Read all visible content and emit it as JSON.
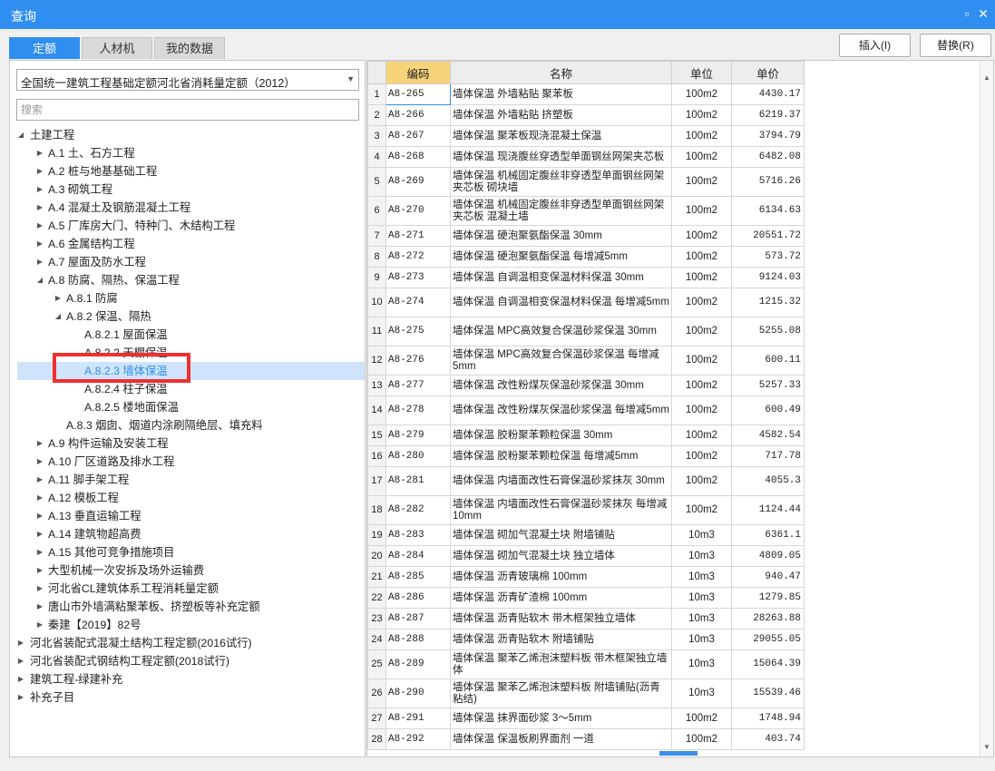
{
  "window": {
    "title": "查询"
  },
  "tabs": [
    {
      "label": "定额",
      "active": true
    },
    {
      "label": "人材机",
      "active": false
    },
    {
      "label": "我的数据",
      "active": false
    }
  ],
  "actions": {
    "insert_label": "插入(I)",
    "replace_label": "替换(R)"
  },
  "left": {
    "quota_book": "全国统一建筑工程基础定额河北省消耗量定额（2012）",
    "search_placeholder": "搜索",
    "tree": [
      {
        "label": "土建工程",
        "level": 1,
        "toggle": "expanded"
      },
      {
        "label": "A.1 土、石方工程",
        "level": 2,
        "toggle": "collapsed"
      },
      {
        "label": "A.2 桩与地基基础工程",
        "level": 2,
        "toggle": "collapsed"
      },
      {
        "label": "A.3 砌筑工程",
        "level": 2,
        "toggle": "collapsed"
      },
      {
        "label": "A.4 混凝土及钢筋混凝土工程",
        "level": 2,
        "toggle": "collapsed"
      },
      {
        "label": "A.5 厂库房大门、特种门、木结构工程",
        "level": 2,
        "toggle": "collapsed"
      },
      {
        "label": "A.6 金属结构工程",
        "level": 2,
        "toggle": "collapsed"
      },
      {
        "label": "A.7 屋面及防水工程",
        "level": 2,
        "toggle": "collapsed"
      },
      {
        "label": "A.8 防腐、隔热、保温工程",
        "level": 2,
        "toggle": "expanded"
      },
      {
        "label": "A.8.1 防腐",
        "level": 3,
        "toggle": "collapsed"
      },
      {
        "label": "A.8.2 保温、隔热",
        "level": 3,
        "toggle": "expanded"
      },
      {
        "label": "A.8.2.1 屋面保温",
        "level": 4,
        "toggle": "none"
      },
      {
        "label": "A.8.2.2 天棚保温",
        "level": 4,
        "toggle": "none"
      },
      {
        "label": "A.8.2.3 墙体保温",
        "level": 4,
        "toggle": "none",
        "selected": true
      },
      {
        "label": "A.8.2.4 柱子保温",
        "level": 4,
        "toggle": "none"
      },
      {
        "label": "A.8.2.5 楼地面保温",
        "level": 4,
        "toggle": "none"
      },
      {
        "label": "A.8.3 烟囱、烟道内涂刷隔绝层、填充料",
        "level": 3,
        "toggle": "none"
      },
      {
        "label": "A.9 构件运输及安装工程",
        "level": 2,
        "toggle": "collapsed"
      },
      {
        "label": "A.10 厂区道路及排水工程",
        "level": 2,
        "toggle": "collapsed"
      },
      {
        "label": "A.11 脚手架工程",
        "level": 2,
        "toggle": "collapsed"
      },
      {
        "label": "A.12 模板工程",
        "level": 2,
        "toggle": "collapsed"
      },
      {
        "label": "A.13 垂直运输工程",
        "level": 2,
        "toggle": "collapsed"
      },
      {
        "label": "A.14 建筑物超高费",
        "level": 2,
        "toggle": "collapsed"
      },
      {
        "label": "A.15 其他可竞争措施项目",
        "level": 2,
        "toggle": "collapsed"
      },
      {
        "label": "大型机械一次安拆及场外运输费",
        "level": 2,
        "toggle": "collapsed"
      },
      {
        "label": "河北省CL建筑体系工程消耗量定额",
        "level": 2,
        "toggle": "collapsed"
      },
      {
        "label": "唐山市外墙满粘聚苯板、挤塑板等补充定额",
        "level": 2,
        "toggle": "collapsed"
      },
      {
        "label": "秦建【2019】82号",
        "level": 2,
        "toggle": "collapsed"
      },
      {
        "label": "河北省装配式混凝土结构工程定额(2016试行)",
        "level": 1,
        "toggle": "collapsed"
      },
      {
        "label": "河北省装配式钢结构工程定额(2018试行)",
        "level": 1,
        "toggle": "collapsed"
      },
      {
        "label": "建筑工程-绿建补充",
        "level": 1,
        "toggle": "collapsed"
      },
      {
        "label": "补充子目",
        "level": 1,
        "toggle": "collapsed"
      }
    ]
  },
  "table": {
    "columns": [
      "编码",
      "名称",
      "单位",
      "单价"
    ],
    "rows": [
      {
        "n": "1",
        "code": "A8-265",
        "name": "墙体保温 外墙粘贴 聚苯板",
        "unit": "100m2",
        "price": "4430.17"
      },
      {
        "n": "2",
        "code": "A8-266",
        "name": "墙体保温 外墙粘贴 挤塑板",
        "unit": "100m2",
        "price": "6219.37"
      },
      {
        "n": "3",
        "code": "A8-267",
        "name": "墙体保温 聚苯板现浇混凝土保温",
        "unit": "100m2",
        "price": "3794.79"
      },
      {
        "n": "4",
        "code": "A8-268",
        "name": "墙体保温 现浇腹丝穿透型单面钢丝网架夹芯板",
        "unit": "100m2",
        "price": "6482.08"
      },
      {
        "n": "5",
        "code": "A8-269",
        "name": "墙体保温 机械固定腹丝非穿透型单面钢丝网架夹芯板 砌块墙",
        "unit": "100m2",
        "price": "5716.26"
      },
      {
        "n": "6",
        "code": "A8-270",
        "name": "墙体保温 机械固定腹丝非穿透型单面钢丝网架夹芯板 混凝土墙",
        "unit": "100m2",
        "price": "6134.63"
      },
      {
        "n": "7",
        "code": "A8-271",
        "name": "墙体保温 硬泡聚氨酯保温 30mm",
        "unit": "100m2",
        "price": "20551.72"
      },
      {
        "n": "8",
        "code": "A8-272",
        "name": "墙体保温 硬泡聚氨酯保温 每增减5mm",
        "unit": "100m2",
        "price": "573.72"
      },
      {
        "n": "9",
        "code": "A8-273",
        "name": "墙体保温 自调温相变保温材料保温 30mm",
        "unit": "100m2",
        "price": "9124.03"
      },
      {
        "n": "10",
        "code": "A8-274",
        "name": "墙体保温 自调温相变保温材料保温 每增减5mm",
        "unit": "100m2",
        "price": "1215.32"
      },
      {
        "n": "11",
        "code": "A8-275",
        "name": "墙体保温 MPC高效复合保温砂浆保温 30mm",
        "unit": "100m2",
        "price": "5255.08"
      },
      {
        "n": "12",
        "code": "A8-276",
        "name": "墙体保温 MPC高效复合保温砂浆保温 每增减5mm",
        "unit": "100m2",
        "price": "600.11"
      },
      {
        "n": "13",
        "code": "A8-277",
        "name": "墙体保温 改性粉煤灰保温砂浆保温 30mm",
        "unit": "100m2",
        "price": "5257.33"
      },
      {
        "n": "14",
        "code": "A8-278",
        "name": "墙体保温 改性粉煤灰保温砂浆保温 每增减5mm",
        "unit": "100m2",
        "price": "600.49"
      },
      {
        "n": "15",
        "code": "A8-279",
        "name": "墙体保温 胶粉聚苯颗粒保温 30mm",
        "unit": "100m2",
        "price": "4582.54"
      },
      {
        "n": "16",
        "code": "A8-280",
        "name": "墙体保温 胶粉聚苯颗粒保温 每增减5mm",
        "unit": "100m2",
        "price": "717.78"
      },
      {
        "n": "17",
        "code": "A8-281",
        "name": "墙体保温 内墙面改性石膏保温砂浆抹灰 30mm",
        "unit": "100m2",
        "price": "4055.3"
      },
      {
        "n": "18",
        "code": "A8-282",
        "name": "墙体保温 内墙面改性石膏保温砂浆抹灰 每增减10mm",
        "unit": "100m2",
        "price": "1124.44"
      },
      {
        "n": "19",
        "code": "A8-283",
        "name": "墙体保温 砌加气混凝土块 附墙铺贴",
        "unit": "10m3",
        "price": "6361.1"
      },
      {
        "n": "20",
        "code": "A8-284",
        "name": "墙体保温 砌加气混凝土块 独立墙体",
        "unit": "10m3",
        "price": "4809.05"
      },
      {
        "n": "21",
        "code": "A8-285",
        "name": "墙体保温 沥青玻璃棉 100mm",
        "unit": "10m3",
        "price": "940.47"
      },
      {
        "n": "22",
        "code": "A8-286",
        "name": "墙体保温 沥青矿渣棉 100mm",
        "unit": "10m3",
        "price": "1279.85"
      },
      {
        "n": "23",
        "code": "A8-287",
        "name": "墙体保温 沥青贴软木 带木框架独立墙体",
        "unit": "10m3",
        "price": "28263.88"
      },
      {
        "n": "24",
        "code": "A8-288",
        "name": "墙体保温 沥青贴软木 附墙铺贴",
        "unit": "10m3",
        "price": "29055.05"
      },
      {
        "n": "25",
        "code": "A8-289",
        "name": "墙体保温 聚苯乙烯泡沫塑料板 带木框架独立墙体",
        "unit": "10m3",
        "price": "15064.39"
      },
      {
        "n": "26",
        "code": "A8-290",
        "name": "墙体保温 聚苯乙烯泡沫塑料板 附墙铺贴(沥青粘结)",
        "unit": "10m3",
        "price": "15539.46"
      },
      {
        "n": "27",
        "code": "A8-291",
        "name": "墙体保温 抹界面砂浆 3～5mm",
        "unit": "100m2",
        "price": "1748.94"
      },
      {
        "n": "28",
        "code": "A8-292",
        "name": "墙体保温 保温板刷界面剂 一道",
        "unit": "100m2",
        "price": "403.74"
      }
    ]
  },
  "colors": {
    "accent": "#2f8ef0",
    "highlight_box": "#ee2f2f",
    "code_header": "#f7d37a",
    "selected_row": "#cfe4fa"
  }
}
